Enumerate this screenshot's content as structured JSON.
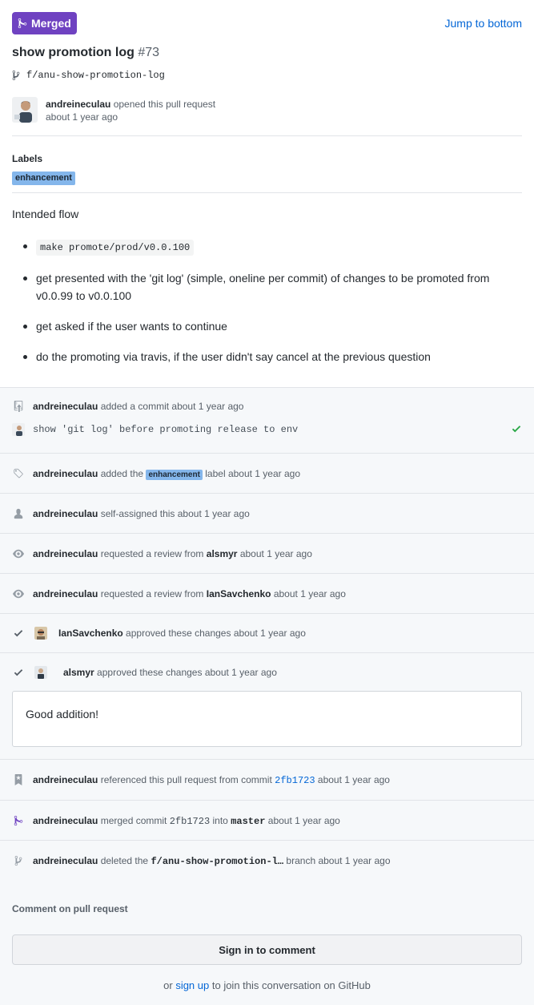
{
  "header": {
    "badge_label": "Merged",
    "jump_label": "Jump to bottom",
    "title": "show promotion log",
    "number": "#73",
    "branch": "f/anu-show-promotion-log"
  },
  "opener": {
    "user": "andreineculau",
    "action": "opened this pull request",
    "time": "about 1 year ago"
  },
  "labels": {
    "heading": "Labels",
    "items": [
      "enhancement"
    ],
    "color": "#84b6eb"
  },
  "description": {
    "intro": "Intended flow",
    "command": "make promote/prod/v0.0.100",
    "items": [
      "get presented with the 'git log' (simple, oneline per commit) of changes to be promoted from v0.0.99 to v0.0.100",
      "get asked if the user wants to continue",
      "do the promoting via travis, if the user didn't say cancel at the previous question"
    ]
  },
  "timeline": {
    "commit_event": {
      "user": "andreineculau",
      "text": "added a commit about 1 year ago",
      "message": "show 'git log' before promoting release to env"
    },
    "label_event": {
      "user": "andreineculau",
      "pre": "added the",
      "label": "enhancement",
      "post": "label about 1 year ago"
    },
    "assign_event": {
      "user": "andreineculau",
      "text": "self-assigned this about 1 year ago"
    },
    "review1": {
      "user": "andreineculau",
      "pre": "requested a review from",
      "target": "alsmyr",
      "post": "about 1 year ago"
    },
    "review2": {
      "user": "andreineculau",
      "pre": "requested a review from",
      "target": "IanSavchenko",
      "post": "about 1 year ago"
    },
    "approve1": {
      "user": "IanSavchenko",
      "text": "approved these changes about 1 year ago"
    },
    "approve2": {
      "user": "alsmyr",
      "text": "approved these changes about 1 year ago",
      "comment": "Good addition!"
    },
    "reference": {
      "user": "andreineculau",
      "pre": "referenced this pull request from commit",
      "sha": "2fb1723",
      "post": "about 1 year ago"
    },
    "merge": {
      "user": "andreineculau",
      "pre": "merged commit",
      "sha": "2fb1723",
      "mid": "into",
      "target": "master",
      "post": "about 1 year ago"
    },
    "delete": {
      "user": "andreineculau",
      "pre": "deleted the",
      "branch": "f/anu-show-promotion-l…",
      "post": "branch about 1 year ago"
    }
  },
  "footer": {
    "heading": "Comment on pull request",
    "signin_label": "Sign in to comment",
    "or": "or",
    "signup_label": "sign up",
    "signup_suffix": "to join this conversation on GitHub"
  },
  "colors": {
    "merged": "#6f42c1",
    "link": "#0366d6",
    "success": "#28a745",
    "label": "#84b6eb"
  }
}
